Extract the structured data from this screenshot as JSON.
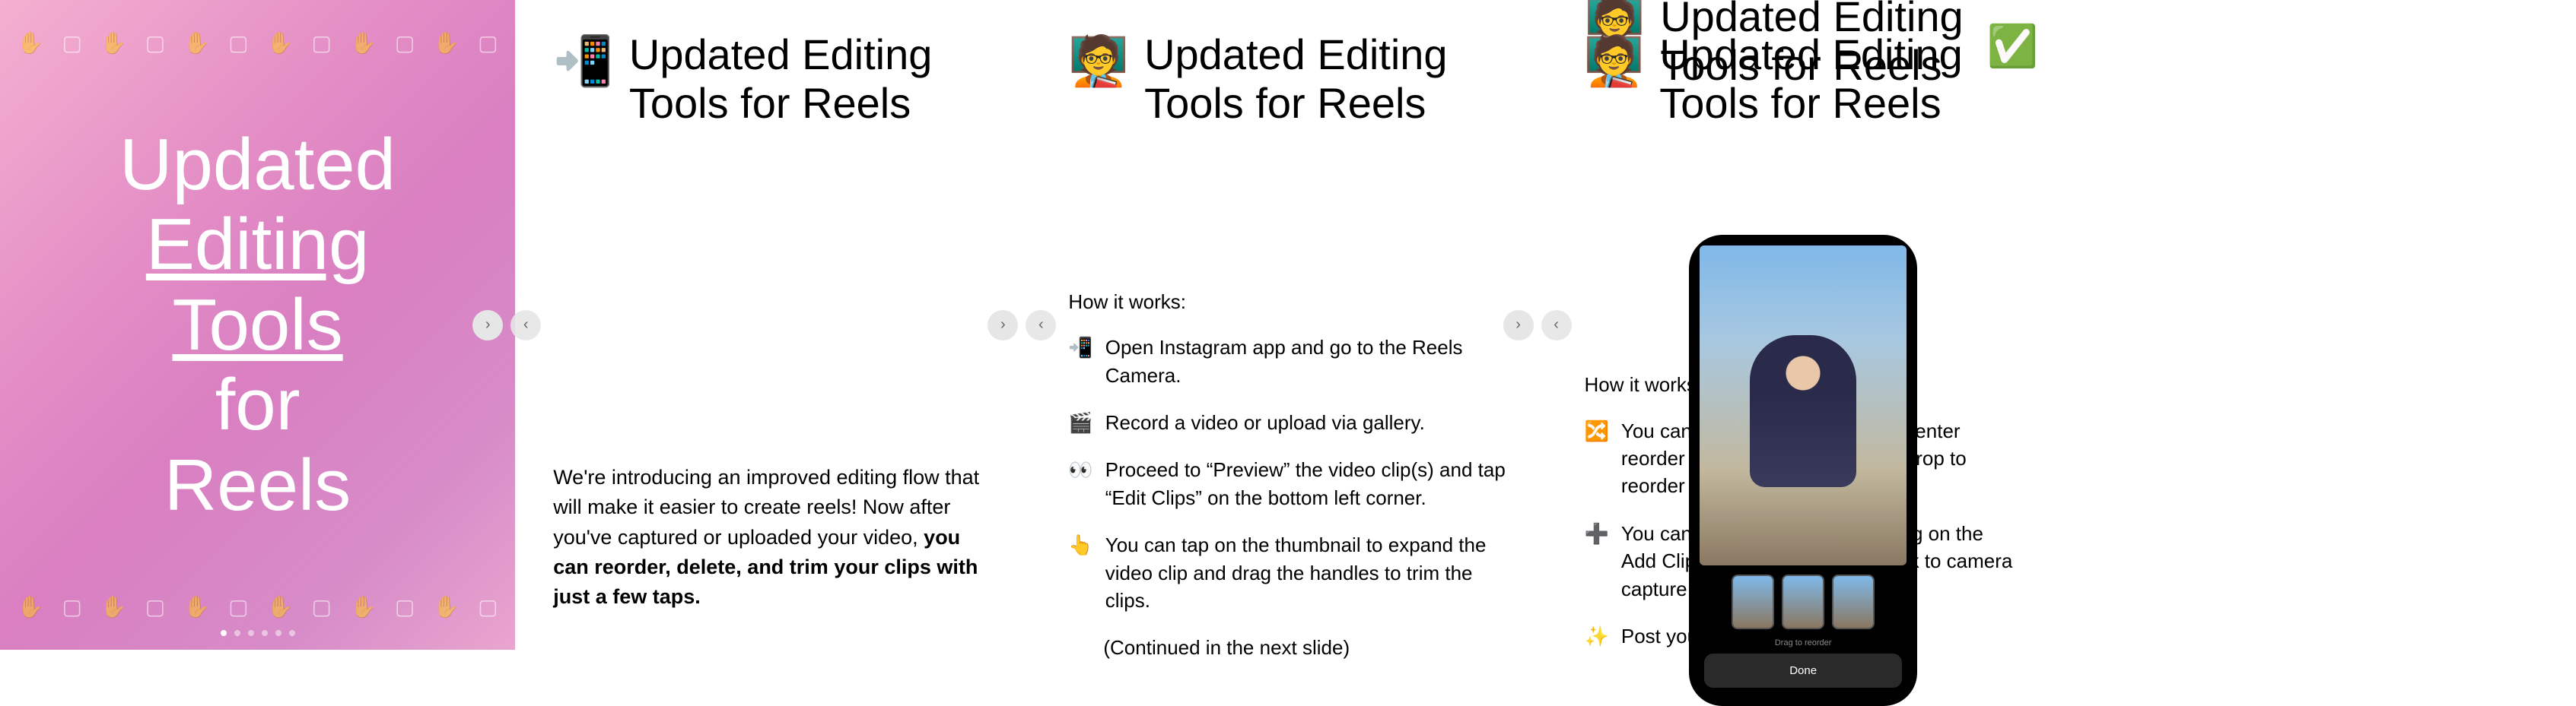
{
  "cover": {
    "line1": "Updated",
    "line2_underlined": "Editing Tools",
    "line3": "for Reels",
    "icons": [
      "✋",
      "📷",
      "✋",
      "📷",
      "✋",
      "📷",
      "✋",
      "📷",
      "✋",
      "📷",
      "✋",
      "📷"
    ]
  },
  "slide2": {
    "emoji": "📲",
    "heading": "Updated Editing Tools for Reels",
    "intro_plain": "We're introducing an improved editing flow that will make it easier to create reels! Now after you've captured or uploaded your video, ",
    "intro_bold": "you can reorder, delete, and trim your clips with just a few taps."
  },
  "slide3": {
    "emoji": "🧑‍🏫",
    "heading": "Updated Editing Tools for Reels",
    "list_title": "How it works:",
    "steps": [
      {
        "emoji": "📲",
        "text": "Open Instagram app and go to the Reels Camera."
      },
      {
        "emoji": "🎬",
        "text": "Record a video or upload via gallery."
      },
      {
        "emoji": "👀",
        "text": "Proceed to “Preview” the video clip(s) and tap “Edit Clips” on the bottom left corner."
      },
      {
        "emoji": "👆",
        "text": "You can tap on the thumbnail to expand the video clip and drag the handles to trim the clips."
      }
    ],
    "continued": "(Continued in the next slide)"
  },
  "slide4": {
    "emoji": "🧑‍🏫",
    "heading": "Updated Editing Tools for Reels",
    "list_title": "How it works (continued):",
    "steps": [
      {
        "emoji": "🔀",
        "text": "You can tap the reorder button to enter reorder mode and use drag and drop to reorder / delete the clips."
      },
      {
        "emoji": "➕",
        "text": "You can add more clips by tapping on the Add Clips Button (brings you back to camera capture mode)."
      },
      {
        "emoji": "✨",
        "text": "Post your Reel when finished!"
      }
    ]
  },
  "slide5": {
    "emoji": "🧑‍🏫",
    "heading": "Updated Editing Tools for Reels",
    "checkmark": "✅",
    "phone": {
      "drag_label": "Drag to reorder",
      "done_button": "Done"
    }
  },
  "nav": {
    "prev": "‹",
    "next": "›"
  }
}
